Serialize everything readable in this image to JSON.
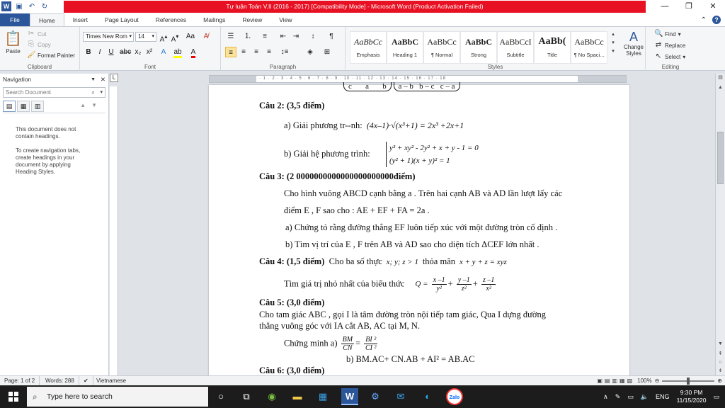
{
  "window": {
    "title": "Tự luận Toán V.II (2016 - 2017) [Compatibility Mode] - Microsoft Word (Product Activation Failed)"
  },
  "tabs": [
    "File",
    "Home",
    "Insert",
    "Page Layout",
    "References",
    "Mailings",
    "Review",
    "View"
  ],
  "clipboard": {
    "paste": "Paste",
    "cut": "Cut",
    "copy": "Copy",
    "format_painter": "Format Painter",
    "label": "Clipboard"
  },
  "font": {
    "name": "Times New Rom",
    "size": "14",
    "label": "Font"
  },
  "paragraph": {
    "label": "Paragraph"
  },
  "styles": {
    "label": "Styles",
    "items": [
      {
        "sample": "AaBbCc",
        "name": "Emphasis"
      },
      {
        "sample": "AaBbC",
        "name": "Heading 1"
      },
      {
        "sample": "AaBbCc",
        "name": "¶ Normal"
      },
      {
        "sample": "AaBbC",
        "name": "Strong"
      },
      {
        "sample": "AaBbCcI",
        "name": "Subtitle"
      },
      {
        "sample": "AaBb(",
        "name": "Title"
      },
      {
        "sample": "AaBbCc",
        "name": "¶ No Spaci..."
      }
    ],
    "change_styles": "Change Styles"
  },
  "editing": {
    "find": "Find",
    "replace": "Replace",
    "select": "Select",
    "label": "Editing"
  },
  "navigation": {
    "title": "Navigation",
    "search_placeholder": "Search Document",
    "msg1": "This document does not contain headings.",
    "msg2": "To create navigation tabs, create headings in your document by applying Heading Styles."
  },
  "document": {
    "cau2": "Câu 2: (3,5 điểm)",
    "cau2a_label": "a) Giải phương tr--nh:",
    "cau2b_label": "b) Giải hệ phương trình:",
    "cau3": "Câu 3: (2 0000000000000000000000điểm)",
    "cau3_l1": "Cho hình vuông ABCD cạnh bằng a .  Trên hai cạnh AB và AD lần lượt  lấy các",
    "cau3_l2": "điểm E , F sao cho : AE + EF + FA = 2a .",
    "cau3_a": "a)  Chứng tỏ rằng đường thẳng EF luôn tiếp xúc với một đường tròn cố định .",
    "cau3_b": "b)  Tìm vị trí của E , F trên AB và AD sao cho diện tích  ΔCEF lớn nhất .",
    "cau4": "Câu 4: (1,5 điểm)",
    "cau4_text": "Cho ba số thực",
    "cau4_cond": "thỏa mãn",
    "cau4_l2": "Tìm giá trị nhỏ nhất của biểu thức",
    "cau5": "Câu 5: (3,0 điểm)",
    "cau5_l1": "Cho tam giác ABC , gọi I là tâm đường tròn nội tiếp tam giác, Qua I dựng đường",
    "cau5_l2": "thẳng vuông góc với IA cắt AB, AC tại M, N.",
    "cau5_a": "Chứng minh  a)",
    "cau5_b": "b) BM.AC+ CN.AB + AI² = AB.AC",
    "cau6": "Câu 6: (3,0 điểm)"
  },
  "status": {
    "page": "Page: 1 of 2",
    "words": "Words: 288",
    "lang": "Vietnamese",
    "zoom": "100%"
  },
  "taskbar": {
    "search": "Type here to search",
    "lang": "ENG",
    "time": "9:30 PM",
    "date": "11/15/2020"
  }
}
